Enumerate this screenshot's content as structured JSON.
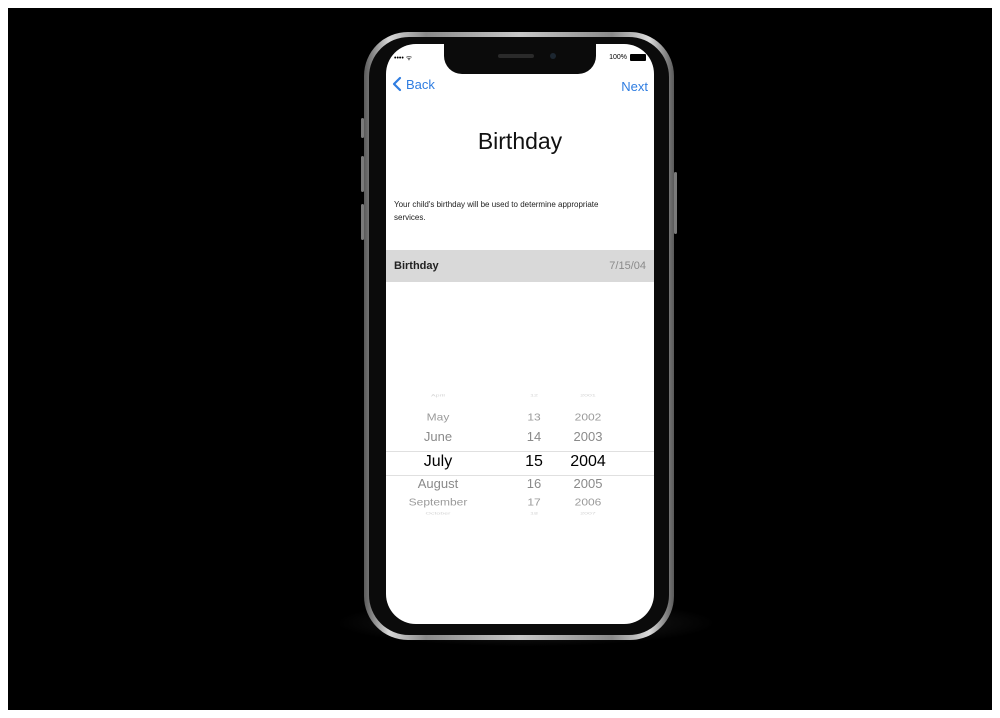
{
  "status_bar": {
    "signal": "•••• ᯤ",
    "battery": "100%"
  },
  "nav": {
    "back_label": "Back",
    "next_label": "Next"
  },
  "page_title": "Birthday",
  "description": "Your child's birthday will be used to determine appropriate services.",
  "birthday_row": {
    "label": "Birthday",
    "value": "7/15/04"
  },
  "picker": {
    "months": [
      "April",
      "May",
      "June",
      "July",
      "August",
      "September",
      "October"
    ],
    "days": [
      "12",
      "13",
      "14",
      "15",
      "16",
      "17",
      "18"
    ],
    "years": [
      "2001",
      "2002",
      "2003",
      "2004",
      "2005",
      "2006",
      "2007"
    ],
    "selected_index": 3
  },
  "colors": {
    "accent": "#2f7de1",
    "row_bg": "#d9d9d9",
    "background": "#000000"
  }
}
